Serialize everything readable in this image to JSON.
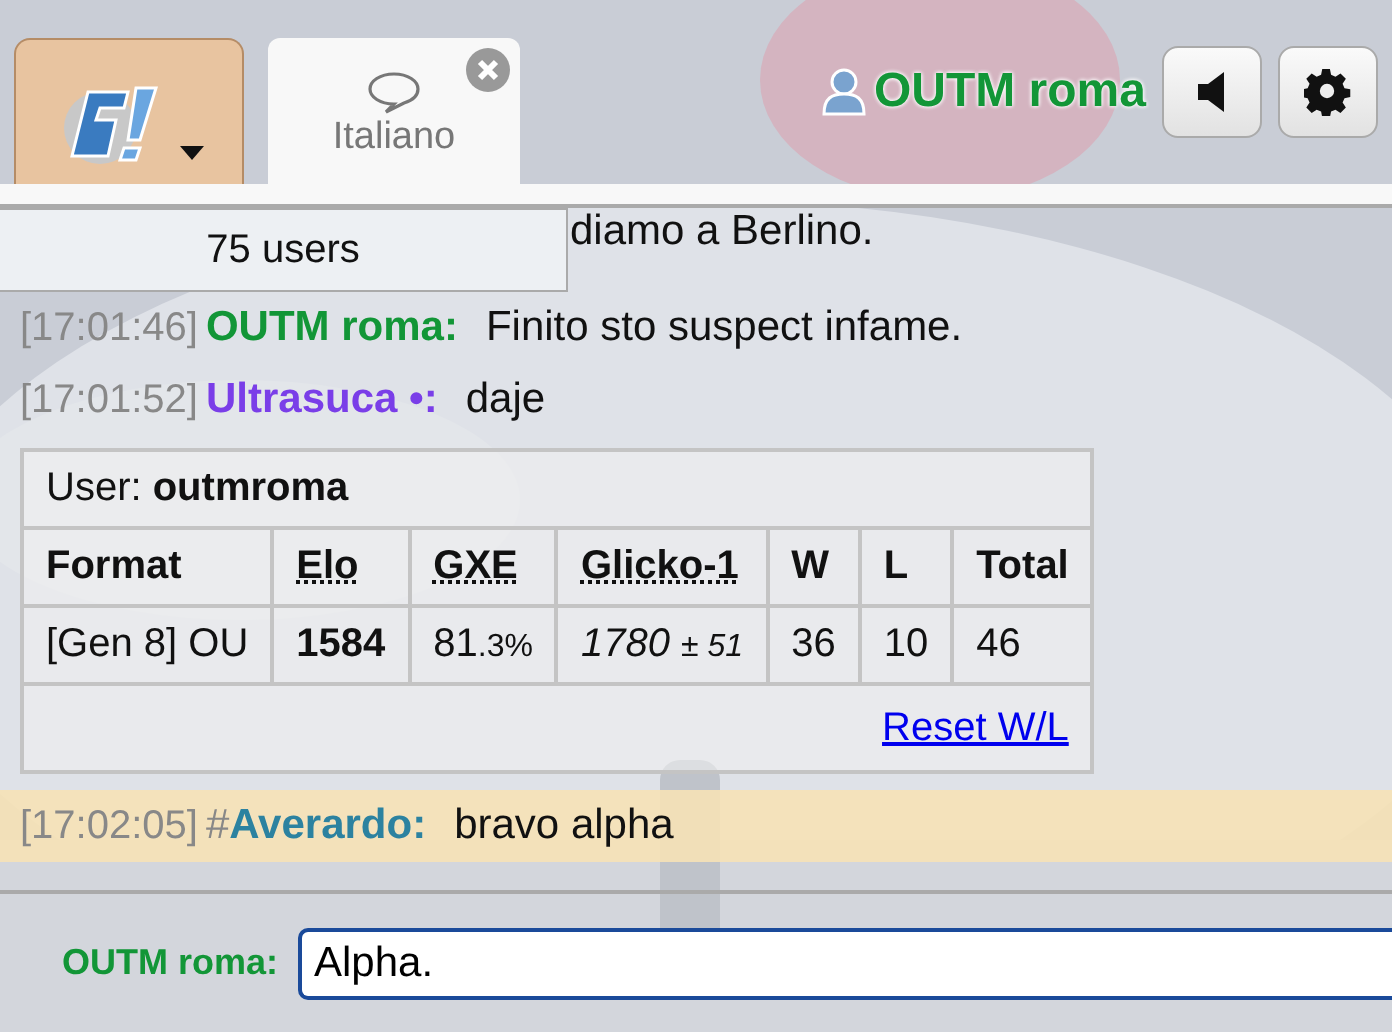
{
  "header": {
    "logo_menu_open": false,
    "tabs": [
      {
        "label": "Italiano",
        "selected": true,
        "closable": true
      }
    ],
    "user": {
      "name": "OUTM roma",
      "color": "#129637"
    }
  },
  "users_popup": {
    "label": "75 users"
  },
  "messages": [
    {
      "kind": "partial",
      "text": "diamo a Berlino.",
      "highlighted": false
    },
    {
      "kind": "chat",
      "time": "[17:01:46]",
      "name": "OUTM roma:",
      "color": "#129637",
      "text": "Finito sto suspect infame.",
      "highlighted": false
    },
    {
      "kind": "chat",
      "time": "[17:01:52]",
      "name": "Ultrasuca •:",
      "color": "#7a3ee8",
      "text": "daje",
      "highlighted": false
    },
    {
      "kind": "table",
      "user_label": "User:",
      "user": "outmroma",
      "columns": [
        {
          "label": "Format",
          "underlined": false
        },
        {
          "label": "Elo",
          "underlined": true
        },
        {
          "label": "GXE",
          "underlined": true
        },
        {
          "label": "Glicko-1",
          "underlined": true
        },
        {
          "label": "W",
          "underlined": false
        },
        {
          "label": "L",
          "underlined": false
        },
        {
          "label": "Total",
          "underlined": false
        }
      ],
      "row": {
        "format": "[Gen 8] OU",
        "elo": "1584",
        "gxe": "81",
        "gxe_decimal": ".3%",
        "glicko": "1780",
        "glicko_deviation": "± 51",
        "w": "36",
        "l": "10",
        "total": "46"
      },
      "link": "Reset W/L"
    },
    {
      "kind": "chat",
      "time": "[17:02:05]",
      "rank": "#",
      "name": "Averardo:",
      "color": "#2c82a0",
      "text": "bravo alpha",
      "highlighted": true
    }
  ],
  "composer": {
    "name": "OUTM roma:",
    "color": "#129637",
    "value": "Alpha."
  }
}
